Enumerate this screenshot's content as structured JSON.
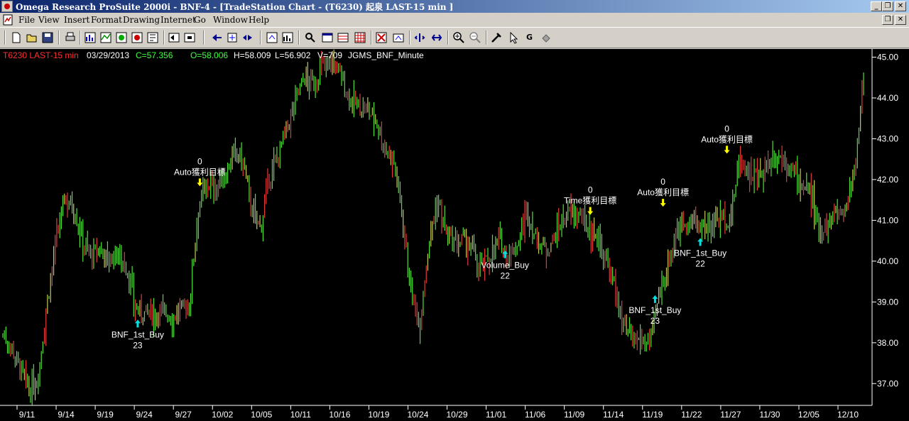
{
  "window": {
    "title": "Omega Research ProSuite 2000i - BNF-4 - [TradeStation Chart - (T6230) 起泉 LAST-15 min ]",
    "controls": [
      "_",
      "❐",
      "✕"
    ]
  },
  "menu": {
    "items": [
      "File",
      "View",
      "Insert",
      "Format",
      "Drawing",
      "Internet",
      "Go",
      "Window",
      "Help"
    ]
  },
  "toolbar": {
    "buttons": [
      "new-icon",
      "open-icon",
      "save-icon",
      "print-icon",
      "insert-chart-icon",
      "insert-indicator-icon",
      "insert-strategy-icon",
      "insert-text-icon",
      "format-icon",
      "back-icon",
      "forward-icon",
      "next-icon",
      "data-window-icon",
      "strategy-report-icon",
      "radar-icon",
      "chart-window-icon",
      "grid-icon",
      "optionstation-icon",
      "bars-icon",
      "zoom-interval-icon",
      "zoom-compress-icon",
      "zoom-in-icon",
      "zoom-out-icon",
      "tools-icon",
      "pointer-icon",
      "gauge-icon",
      "help-icon"
    ]
  },
  "colors": {
    "up_bar": "#52e03a",
    "down_bar": "#e23a3a",
    "mixed_bar": "#c8c85a",
    "buy_arrow": "#00e0e0",
    "sell_arrow": "#ffff00",
    "symbol_text": "#ff3030",
    "close_text": "#40ff40",
    "open_text": "#40ff40",
    "label_text": "#ffffff"
  },
  "chart_header": {
    "symbol": "T6230 LAST-15 min",
    "date": "03/29/2013",
    "close": "C=57.356",
    "open": "O=58.006",
    "high": "H=58.009",
    "low": "L=56.902",
    "volume": "V=709",
    "study": "JGMS_BNF_Minute"
  },
  "chart_data": {
    "type": "bar",
    "y_axis": {
      "min": 36.5,
      "max": 45.2,
      "ticks": [
        "45.00",
        "44.00",
        "43.00",
        "42.00",
        "41.00",
        "40.00",
        "39.00",
        "38.00",
        "37.00"
      ]
    },
    "x_ticks": [
      "9/11",
      "9/14",
      "9/19",
      "9/24",
      "9/27",
      "10/02",
      "10/05",
      "10/11",
      "10/16",
      "10/19",
      "10/24",
      "10/29",
      "11/01",
      "11/06",
      "11/09",
      "11/14",
      "11/19",
      "11/22",
      "11/27",
      "11/30",
      "12/05",
      "12/10"
    ],
    "price_path": [
      [
        0,
        38.2
      ],
      [
        1,
        37.9
      ],
      [
        2,
        37.3
      ],
      [
        3,
        36.8
      ],
      [
        4,
        37.2
      ],
      [
        5,
        39.0
      ],
      [
        6,
        40.5
      ],
      [
        7,
        41.6
      ],
      [
        8,
        41.3
      ],
      [
        9,
        40.5
      ],
      [
        10,
        40.1
      ],
      [
        11,
        40.3
      ],
      [
        12,
        40.0
      ],
      [
        13,
        40.2
      ],
      [
        14,
        39.8
      ],
      [
        15,
        38.8
      ],
      [
        16,
        38.7
      ],
      [
        17,
        38.7
      ],
      [
        18,
        38.8
      ],
      [
        19,
        38.6
      ],
      [
        20,
        38.8
      ],
      [
        21,
        38.9
      ],
      [
        22,
        41.3
      ],
      [
        23,
        41.9
      ],
      [
        24,
        41.8
      ],
      [
        25,
        42.1
      ],
      [
        26,
        42.6
      ],
      [
        27,
        42.5
      ],
      [
        28,
        41.3
      ],
      [
        29,
        40.8
      ],
      [
        30,
        42.0
      ],
      [
        31,
        42.6
      ],
      [
        32,
        43.2
      ],
      [
        33,
        44.0
      ],
      [
        34,
        44.5
      ],
      [
        35,
        44.3
      ],
      [
        36,
        44.8
      ],
      [
        37,
        44.9
      ],
      [
        38,
        44.6
      ],
      [
        39,
        44.0
      ],
      [
        40,
        43.8
      ],
      [
        41,
        43.7
      ],
      [
        42,
        43.5
      ],
      [
        43,
        42.8
      ],
      [
        44,
        42.5
      ],
      [
        45,
        41.2
      ],
      [
        46,
        39.2
      ],
      [
        47,
        38.5
      ],
      [
        48,
        40.5
      ],
      [
        49,
        41.5
      ],
      [
        50,
        40.6
      ],
      [
        51,
        40.4
      ],
      [
        52,
        40.5
      ],
      [
        53,
        40.2
      ],
      [
        54,
        39.8
      ],
      [
        55,
        40.2
      ],
      [
        56,
        40.5
      ],
      [
        57,
        40.1
      ],
      [
        58,
        40.4
      ],
      [
        59,
        41.2
      ],
      [
        60,
        40.6
      ],
      [
        61,
        40.3
      ],
      [
        62,
        40.5
      ],
      [
        63,
        41.0
      ],
      [
        64,
        41.2
      ],
      [
        65,
        41.1
      ],
      [
        66,
        40.8
      ],
      [
        67,
        40.6
      ],
      [
        68,
        40.0
      ],
      [
        69,
        39.3
      ],
      [
        70,
        38.3
      ],
      [
        71,
        38.0
      ],
      [
        72,
        38.1
      ],
      [
        73,
        38.0
      ],
      [
        74,
        39.2
      ],
      [
        75,
        40.0
      ],
      [
        76,
        40.8
      ],
      [
        77,
        41.0
      ],
      [
        78,
        40.9
      ],
      [
        79,
        40.8
      ],
      [
        80,
        41.0
      ],
      [
        81,
        41.1
      ],
      [
        82,
        41.0
      ],
      [
        83,
        42.5
      ],
      [
        84,
        42.2
      ],
      [
        85,
        42.0
      ],
      [
        86,
        42.3
      ],
      [
        87,
        42.6
      ],
      [
        88,
        42.5
      ],
      [
        89,
        42.2
      ],
      [
        90,
        41.9
      ],
      [
        91,
        41.6
      ],
      [
        92,
        40.8
      ],
      [
        93,
        40.9
      ],
      [
        94,
        41.2
      ],
      [
        95,
        41.3
      ],
      [
        96,
        42.3
      ],
      [
        97,
        44.4
      ]
    ],
    "annotations": [
      {
        "kind": "buy",
        "label": "BNF_1st_Buy",
        "count": "23",
        "x": 15.2,
        "y": 38.6
      },
      {
        "kind": "sell",
        "label": "Auto獲利目標",
        "count": "0",
        "x": 22.2,
        "y": 41.8
      },
      {
        "kind": "buy",
        "label": "Volume_Buy",
        "count": "22",
        "x": 56.6,
        "y": 40.3
      },
      {
        "kind": "sell",
        "label": "Time獲利目標",
        "count": "0",
        "x": 66.2,
        "y": 41.1
      },
      {
        "kind": "sell",
        "label": "Auto獲利目標",
        "count": "0",
        "x": 74.4,
        "y": 41.3
      },
      {
        "kind": "buy",
        "label": "BNF_1st_Buy",
        "count": "23",
        "x": 73.5,
        "y": 39.2
      },
      {
        "kind": "buy",
        "label": "BNF_1st_Buy",
        "count": "22",
        "x": 78.6,
        "y": 40.6
      },
      {
        "kind": "sell",
        "label": "Auto獲利目標",
        "count": "0",
        "x": 81.6,
        "y": 42.6
      }
    ]
  }
}
